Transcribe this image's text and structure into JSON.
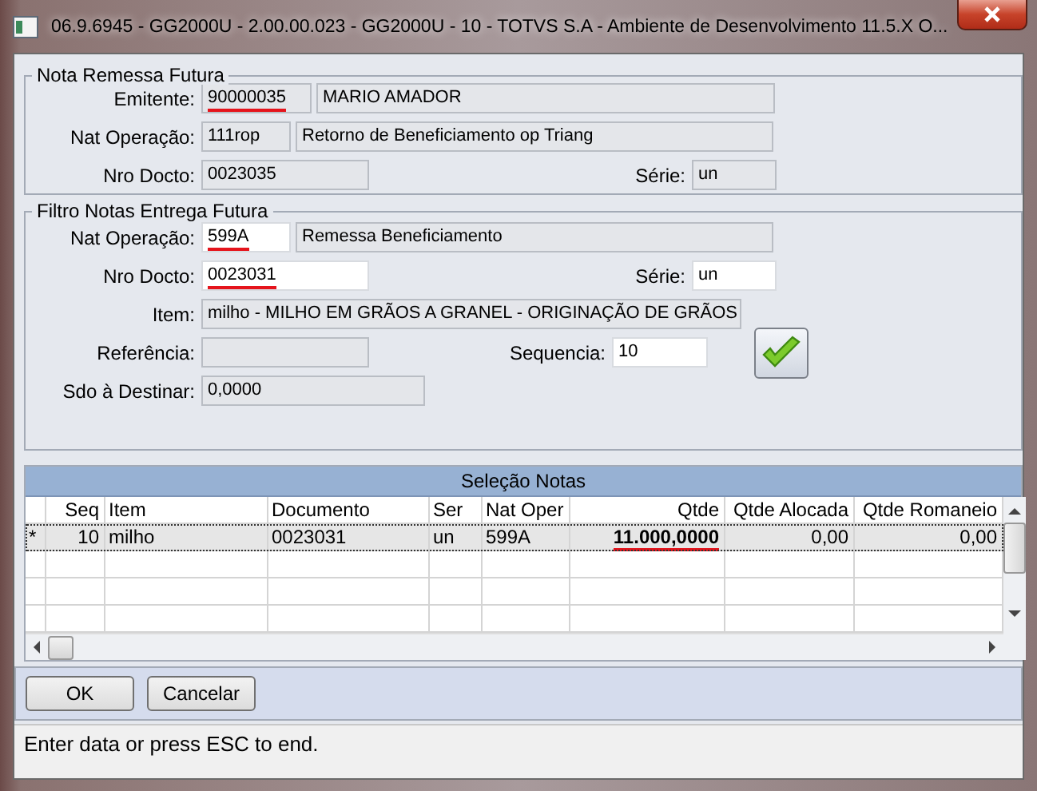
{
  "window": {
    "title": "06.9.6945 - GG2000U - 2.00.00.023 - GG2000U - 10 - TOTVS S.A - Ambiente de Desenvolvimento 11.5.X O..."
  },
  "groups": [
    {
      "legend": "Nota Remessa Futura",
      "rows": [
        [
          {
            "kind": "label",
            "text": "Emitente:"
          },
          {
            "kind": "field",
            "value": "90000035",
            "enabled": false,
            "underlined": true
          },
          {
            "kind": "field",
            "value": "MARIO AMADOR",
            "enabled": false
          }
        ],
        [
          {
            "kind": "label",
            "text": "Nat Operação:"
          },
          {
            "kind": "field",
            "value": "111rop",
            "enabled": false
          },
          {
            "kind": "field",
            "value": "Retorno de Beneficiamento op Triang",
            "enabled": false
          }
        ],
        [
          {
            "kind": "label",
            "text": "Nro Docto:"
          },
          {
            "kind": "field",
            "value": "0023035",
            "enabled": false
          },
          {
            "kind": "label",
            "text": "Série:"
          },
          {
            "kind": "field",
            "value": "un",
            "enabled": false
          }
        ]
      ]
    },
    {
      "legend": "Filtro Notas Entrega Futura",
      "rows": [
        [
          {
            "kind": "label",
            "text": "Nat Operação:"
          },
          {
            "kind": "field",
            "value": "599A",
            "enabled": true,
            "underlined": true
          },
          {
            "kind": "field",
            "value": "Remessa Beneficiamento",
            "enabled": false
          }
        ],
        [
          {
            "kind": "label",
            "text": "Nro Docto:"
          },
          {
            "kind": "field",
            "value": "0023031",
            "enabled": true,
            "underlined": true
          },
          {
            "kind": "label",
            "text": "Série:"
          },
          {
            "kind": "field",
            "value": "un",
            "enabled": true
          }
        ],
        [
          {
            "kind": "label",
            "text": "Item:"
          },
          {
            "kind": "field",
            "value": "milho - MILHO EM GRÃOS A GRANEL - ORIGINAÇÃO DE GRÃOS",
            "enabled": false
          },
          {
            "kind": "button"
          }
        ],
        [
          {
            "kind": "label",
            "text": "Referência:"
          },
          {
            "kind": "field",
            "enabled": false
          },
          {
            "kind": "label",
            "text": "Sequencia:"
          },
          {
            "kind": "field",
            "value": "10",
            "enabled": true
          }
        ],
        [
          {
            "kind": "label",
            "text": "Sdo à Destinar:"
          },
          {
            "kind": "field",
            "value": "0,0000",
            "enabled": false
          }
        ]
      ]
    }
  ],
  "table": {
    "title": "Seleção Notas",
    "columns": [
      "Seq",
      "Item",
      "Documento",
      "Ser",
      "Nat Oper",
      "Qtde",
      "Qtde Alocada",
      "Qtde Romaneio"
    ],
    "rows": [
      {
        "marker": "*",
        "selected": true,
        "cells": [
          {
            "text": "10"
          },
          {
            "text": "milho"
          },
          {
            "text": "0023031"
          },
          {
            "text": "un"
          },
          {
            "text": "599A"
          },
          {
            "text": "11.000,0000",
            "bold": true,
            "underlined": true
          },
          {
            "text": "0,00"
          },
          {
            "text": "0,00"
          }
        ]
      }
    ]
  },
  "buttons": [
    "OK",
    "Cancelar"
  ],
  "status_bar": "Enter data or press ESC to end."
}
